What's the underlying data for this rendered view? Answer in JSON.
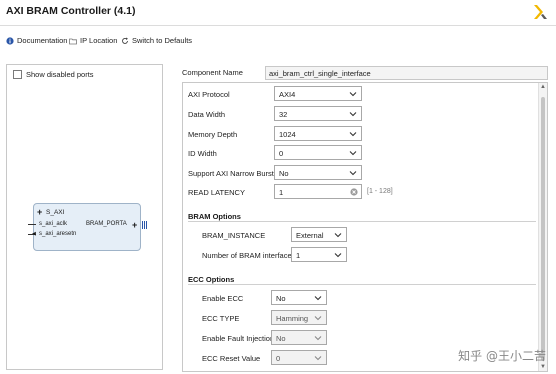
{
  "window": {
    "title": "AXI BRAM Controller (4.1)"
  },
  "toolbar": {
    "documentation": "Documentation",
    "ip_location": "IP Location",
    "switch_defaults": "Switch to Defaults"
  },
  "left": {
    "show_disabled": "Show disabled ports",
    "block": {
      "s_axi": "S_AXI",
      "s_axi_aclk": "s_axi_aclk",
      "s_axi_aresetn": "s_axi_aresetn",
      "bram_porta": "BRAM_PORTA"
    }
  },
  "component": {
    "label": "Component Name",
    "value": "axi_bram_ctrl_single_interface"
  },
  "fields": {
    "axi_protocol": {
      "label": "AXI Protocol",
      "value": "AXI4"
    },
    "data_width": {
      "label": "Data Width",
      "value": "32"
    },
    "memory_depth": {
      "label": "Memory Depth",
      "value": "1024"
    },
    "id_width": {
      "label": "ID Width",
      "value": "0"
    },
    "narrow_bursts": {
      "label": "Support AXI Narrow Bursts",
      "value": "No"
    },
    "read_latency": {
      "label": "READ LATENCY",
      "value": "1",
      "range": "[1 - 128]"
    }
  },
  "bram": {
    "title": "BRAM Options",
    "instance": {
      "label": "BRAM_INSTANCE",
      "value": "External"
    },
    "interfaces": {
      "label": "Number of BRAM interfaces",
      "value": "1"
    }
  },
  "ecc": {
    "title": "ECC Options",
    "enable": {
      "label": "Enable ECC",
      "value": "No"
    },
    "type": {
      "label": "ECC TYPE",
      "value": "Hamming"
    },
    "fault": {
      "label": "Enable Fault Injection",
      "value": "No"
    },
    "reset": {
      "label": "ECC Reset Value",
      "value": "0"
    }
  },
  "watermark": "知乎 @王小二苦",
  "colors": {
    "accent": "#2a56a8",
    "logo": "#f2b800"
  }
}
